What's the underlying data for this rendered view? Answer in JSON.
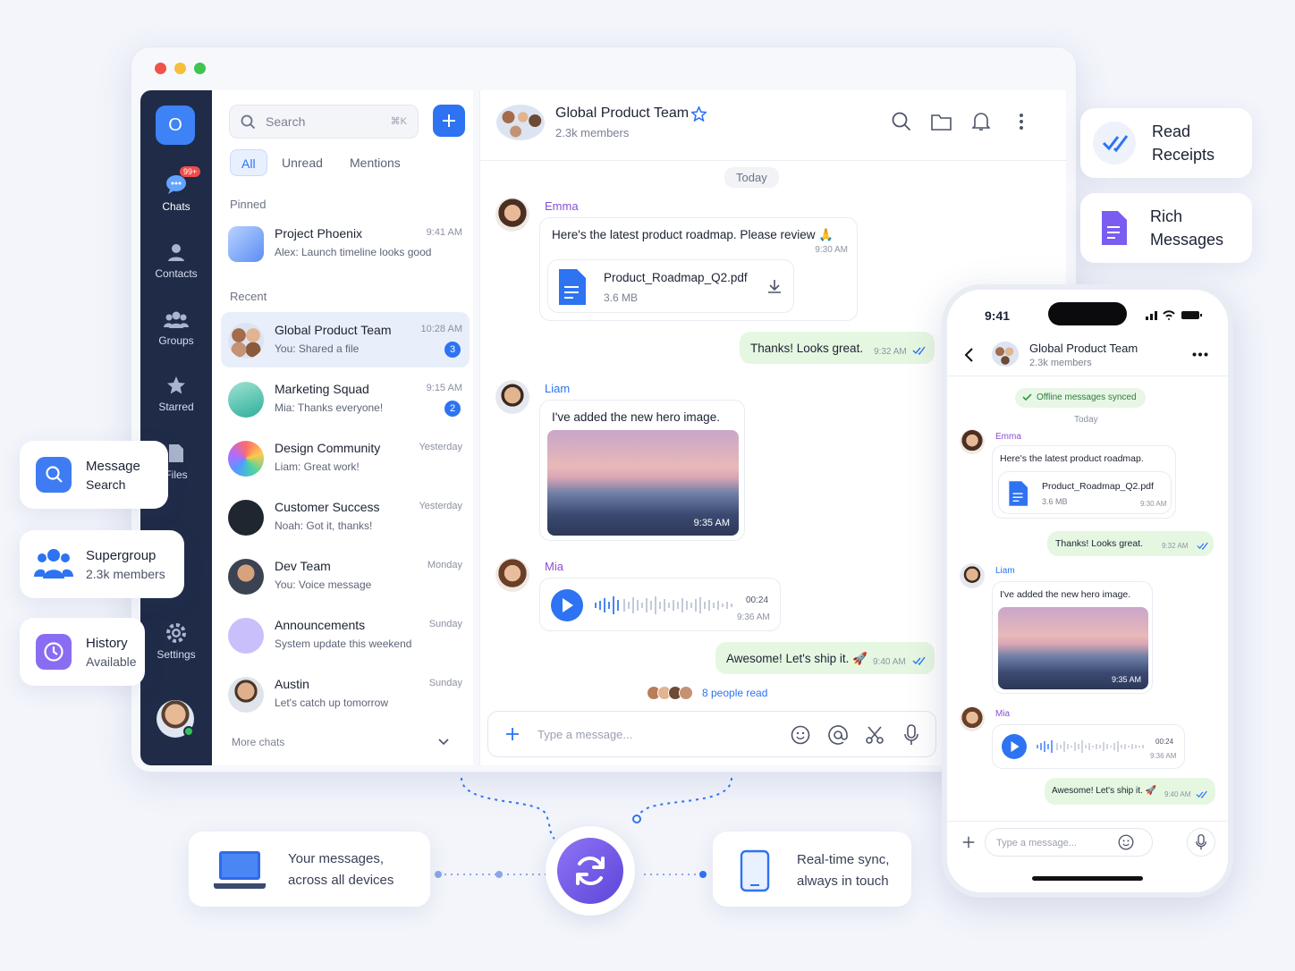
{
  "window": {
    "controls": [
      "close",
      "minimize",
      "maximize"
    ]
  },
  "rail": {
    "logo": "O",
    "chats_badge": "99+",
    "items": [
      {
        "label": "Chats",
        "icon": "chat-bubble-icon"
      },
      {
        "label": "Contacts",
        "icon": "person-icon"
      },
      {
        "label": "Groups",
        "icon": "group-icon"
      },
      {
        "label": "Starred",
        "icon": "star-icon"
      },
      {
        "label": "Files",
        "icon": "file-icon"
      },
      {
        "label": "Settings",
        "icon": "gear-icon"
      }
    ]
  },
  "list": {
    "search_placeholder": "Search",
    "search_shortcut": "⌘K",
    "filters": [
      "All",
      "Unread",
      "Mentions"
    ],
    "pinned_label": "Pinned",
    "recent_label": "Recent",
    "more": "More chats",
    "pinned": {
      "name": "Project Phoenix",
      "preview": "Alex: Launch timeline looks good",
      "time": "9:41 AM"
    },
    "recent": [
      {
        "name": "Global Product Team",
        "preview": "You: Shared a file",
        "time": "10:28 AM",
        "badge": "3"
      },
      {
        "name": "Marketing Squad",
        "preview": "Mia: Thanks everyone!",
        "time": "9:15 AM",
        "badge": "2"
      },
      {
        "name": "Design Community",
        "preview": "Liam: Great work!",
        "time": "Yesterday",
        "badge": ""
      },
      {
        "name": "Customer Success",
        "preview": "Noah: Got it, thanks!",
        "time": "Yesterday",
        "badge": ""
      },
      {
        "name": "Dev Team",
        "preview": "You: Voice message",
        "time": "Monday",
        "badge": ""
      },
      {
        "name": "Announcements",
        "preview": "System update this weekend",
        "time": "Sunday",
        "badge": ""
      },
      {
        "name": "Austin",
        "preview": "Let's catch up tomorrow",
        "time": "Sunday",
        "badge": ""
      }
    ]
  },
  "chat": {
    "title": "Global Product Team",
    "members": "2.3k members",
    "day": "Today",
    "m1": {
      "sender": "Emma",
      "text": "Here's the latest product roadmap. Please review 🙏",
      "time": "9:30 AM",
      "file": "Product_Roadmap_Q2.pdf",
      "size": "3.6 MB"
    },
    "m2": {
      "text": "Thanks! Looks great.",
      "time": "9:32 AM"
    },
    "m3": {
      "sender": "Liam",
      "text": "I've added the new hero image.",
      "time": "9:35 AM"
    },
    "m4": {
      "sender": "Mia",
      "duration": "00:24",
      "time": "9:36 AM"
    },
    "m5": {
      "text": "Awesome! Let's ship it. 🚀",
      "time": "9:40 AM"
    },
    "read": "8 people read",
    "input_placeholder": "Type a message..."
  },
  "features": {
    "read_receipts": [
      "Read",
      "Receipts"
    ],
    "rich": [
      "Rich",
      "Messages"
    ],
    "search": [
      "Message",
      "Search"
    ],
    "supergroup": [
      "Supergroup",
      "2.3k members"
    ],
    "history": [
      "History",
      "Available"
    ]
  },
  "sync": {
    "left": [
      "Your messages,",
      "across all devices"
    ],
    "right": [
      "Real-time sync,",
      "always in touch"
    ]
  },
  "phone": {
    "time": "9:41",
    "title": "Global Product Team",
    "members": "2.3k members",
    "synced": "Offline messages synced",
    "day": "Today",
    "m1": {
      "sender": "Emma",
      "text": "Here's the latest product roadmap.",
      "file": "Product_Roadmap_Q2.pdf",
      "size": "3.6 MB",
      "time": "9:30 AM"
    },
    "m2": {
      "text": "Thanks! Looks great.",
      "time": "9:32 AM"
    },
    "m3": {
      "sender": "Liam",
      "text": "I've added the new hero image.",
      "time": "9:35 AM"
    },
    "m4": {
      "sender": "Mia",
      "duration": "00:24",
      "time": "9:36 AM"
    },
    "m5": {
      "text": "Awesome! Let's ship it. 🚀",
      "time": "9:40 AM"
    },
    "input_placeholder": "Type a message..."
  },
  "colors": {
    "accent": "#2d73f2",
    "rail": "#1f2b47",
    "purple": "#7b5cf0",
    "mine": "#e6f7e1"
  }
}
